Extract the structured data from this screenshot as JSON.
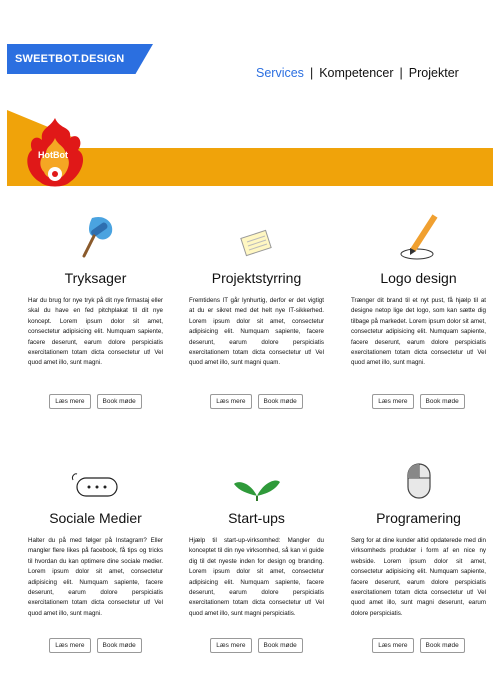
{
  "brand": {
    "name": "SWEETBOT.DESIGN",
    "banner_label": "HotBot"
  },
  "nav": {
    "items": [
      "Services",
      "Kompetencer",
      "Projekter"
    ],
    "separator": "|"
  },
  "buttons": {
    "read_more": "Læs mere",
    "book": "Book møde"
  },
  "cards": [
    {
      "title": "Tryksager",
      "icon": "paint-roller-icon",
      "text": "Har du brug for nye tryk på dit nye firmastaj eller skal du have en fed pitchplakat til dit nye koncept. Lorem ipsum dolor sit amet, consectetur adipisicing elit. Numquam sapiente, facere deserunt, earum dolore perspiciatis exercitationem totam dicta consectetur ut! Vel quod amet illo, sunt magni."
    },
    {
      "title": "Projektstyrring",
      "icon": "notepad-icon",
      "text": "Fremtidens IT går lynhurtig, derfor er det vigtigt at du er sikret med det helt nye IT-sikkerhed. Lorem ipsum dolor sit amet, consectetur adipisicing elit. Numquam sapiente, facere deserunt, earum dolore perspiciatis exercitationem totam dicta consectetur ut! Vel quod amet illo, sunt magni quam."
    },
    {
      "title": "Logo design",
      "icon": "pencil-icon",
      "text": "Trænger dit brand til et nyt pust, få hjælp til at designe netop lige det logo, som kan sætte dig tilbage på markedet. Lorem ipsum dolor sit amet, consectetur adipisicing elit. Numquam sapiente, facere deserunt, earum dolore perspiciatis exercitationem totam dicta consectetur ut! Vel quod amet illo, sunt magni."
    },
    {
      "title": "Sociale Medier",
      "icon": "chat-bubble-icon",
      "text": "Halter du på med følger på Instagram? Eller mangler flere likes på facebook, få tips og tricks til hvordan du kan optimere dine sociale medier. Lorem ipsum dolor sit amet, consectetur adipisicing elit. Numquam sapiente, facere deserunt, earum dolore perspiciatis exercitationem totam dicta consectetur ut! Vel quod amet illo, sunt magni."
    },
    {
      "title": "Start-ups",
      "icon": "sprout-icon",
      "text": "Hjælp til start-up-virksomhed: Mangler du konceptet til din nye virksomhed, så kan vi guide dig til det nyeste inden for design og branding. Lorem ipsum dolor sit amet, consectetur adipisicing elit. Numquam sapiente, facere deserunt, earum dolore perspiciatis exercitationem totam dicta consectetur ut! Vel quod amet illo, sunt magni perspiciatis."
    },
    {
      "title": "Programering",
      "icon": "mouse-icon",
      "text": "Sørg for at dine kunder altid opdaterede med din virksomheds produkter i form af en nice ny webside. Lorem ipsum dolor sit amet, consectetur adipisicing elit. Numquam sapiente, facere deserunt, earum dolore perspiciatis exercitationem totam dicta consectetur ut! Vel quod amet illo, sunt magni deserunt, earum dolore perspiciatis."
    }
  ]
}
